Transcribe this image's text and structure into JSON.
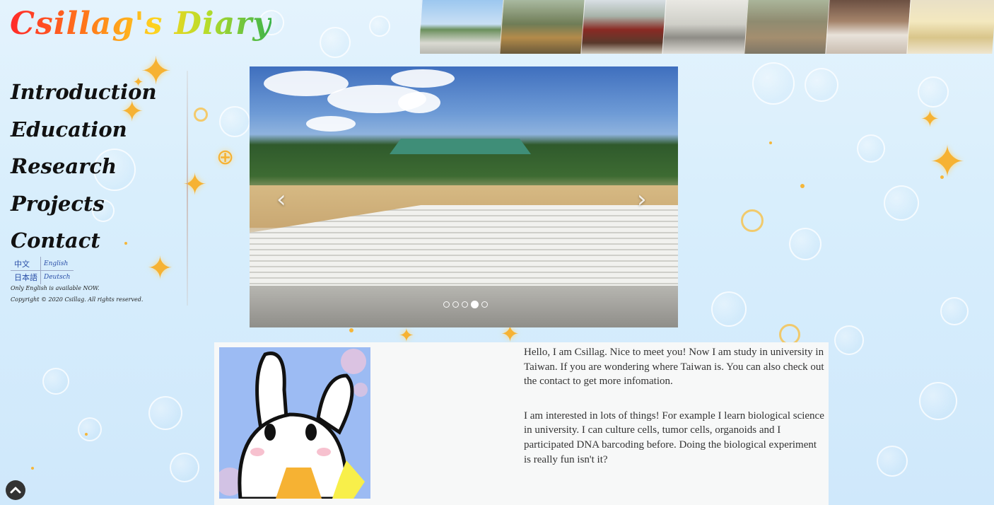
{
  "site": {
    "title": "Csillag's Diary"
  },
  "nav": {
    "items": [
      {
        "label": "Introduction"
      },
      {
        "label": "Education"
      },
      {
        "label": "Research"
      },
      {
        "label": "Projects"
      },
      {
        "label": "Contact"
      }
    ]
  },
  "languages": {
    "chinese": "中文",
    "english": "English",
    "japanese": "日本語",
    "german": "Deutsch",
    "note": "Only English is available NOW.",
    "copyright": "Copyright © 2020 Csillag. All rights reserved."
  },
  "carousel": {
    "prev_icon": "‹",
    "next_icon": "›",
    "slide_count": 5,
    "active_index": 3
  },
  "intro": {
    "paragraphs": [
      "Hello, I am Csillag. Nice to meet you! Now I am study in university in Taiwan. If you are wondering where Taiwan is. You can also check out the contact to get more infomation.",
      "I am interested in lots of things! For example I learn biological science in university. I can culture cells, tumor cells, organoids and I participated DNA barcoding before. Doing the biological experiment is really fun isn't it?"
    ]
  },
  "to_top": {
    "icon": "chevron-up-icon"
  },
  "colors": {
    "accent_gold": "#f6b233",
    "link_blue": "#2a4fa8",
    "panel": "#f8f8f8"
  }
}
